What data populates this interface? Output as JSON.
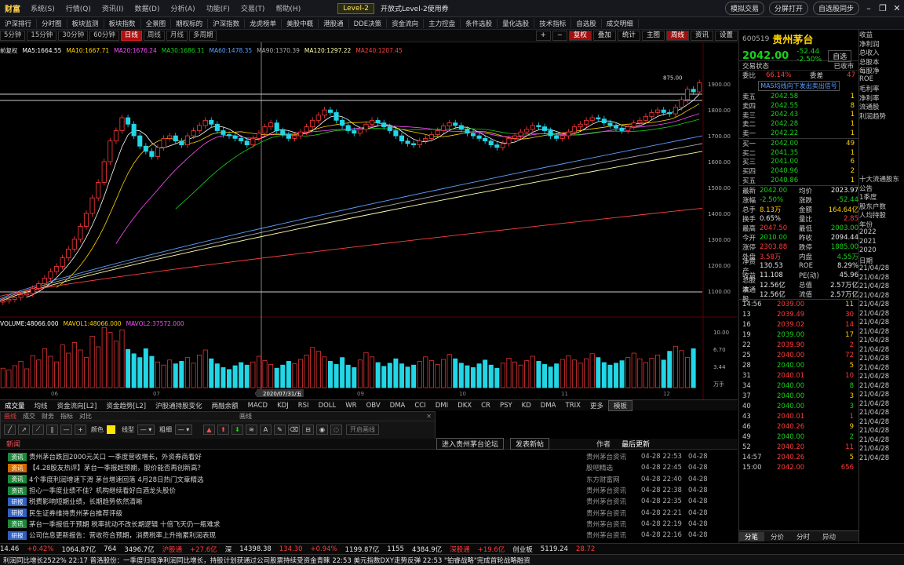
{
  "menubar": {
    "logo": "财富",
    "items": [
      "系统(S)",
      "行情(Q)",
      "资讯(I)",
      "数据(D)",
      "分析(A)",
      "功能(F)",
      "交易(T)",
      "帮助(H)"
    ],
    "promo": "Level-2",
    "promo2": "开放式Level-2使用券",
    "right_items": [
      "模拟交易",
      "分屏打开",
      "自选股同步"
    ]
  },
  "toolbar": {
    "items": [
      "沪深排行",
      "分时图",
      "板块监测",
      "板块指数",
      "全景图",
      "期权标的",
      "沪深指数",
      "龙虎榜单",
      "美股中概",
      "港股通",
      "DDE决策",
      "资金流向",
      "主力控盘",
      "条件选股",
      "量化选股",
      "技术指标",
      "自选股",
      "成交明细"
    ]
  },
  "periodbar": {
    "periods": [
      "5分钟",
      "15分钟",
      "30分钟",
      "60分钟",
      "日线",
      "周线",
      "月线",
      "多周期"
    ],
    "active_index": 4,
    "tools": [
      "+",
      "−",
      "复权",
      "叠加",
      "统计",
      "主图",
      "周线",
      "资讯",
      "设置"
    ]
  },
  "chart_legend": {
    "prefix": "前复权",
    "ma": [
      {
        "label": "MA5:1664.55",
        "color": "#ffffff"
      },
      {
        "label": "MA10:1667.71",
        "color": "#ffd200"
      },
      {
        "label": "MA20:1676.24",
        "color": "#ff4aff"
      },
      {
        "label": "MA30:1686.31",
        "color": "#19d219"
      },
      {
        "label": "MA60:1478.35",
        "color": "#5aa0ff"
      },
      {
        "label": "MA90:1370.39",
        "color": "#aaaaaa"
      },
      {
        "label": "MA120:1297.22",
        "color": "#ffffaa"
      },
      {
        "label": "MA240:1207.45",
        "color": "#ff4040"
      }
    ],
    "vol": [
      {
        "label": "VOLUME:48066.000",
        "color": "#ffffff"
      },
      {
        "label": "MAVOL1:48066.000",
        "color": "#ffd200"
      },
      {
        "label": "MAVOL2:37572.000",
        "color": "#ff4aff"
      }
    ]
  },
  "chart_data": {
    "type": "candlestick",
    "title": "",
    "price_axis": [
      "1900.00",
      "1800.00",
      "1700.00",
      "1600.00",
      "1500.00",
      "1400.00",
      "1300.00",
      "1200.00",
      "1100.00"
    ],
    "volume_axis": [
      "10.00",
      "6.70",
      "3.44",
      "万手"
    ],
    "date_labels": [
      "06",
      "07",
      "08",
      "09",
      "10",
      "11",
      "12"
    ],
    "cursor_date": "2020/07/31/五",
    "peak_label": "875.00",
    "ylim": [
      1060,
      1940
    ],
    "closes": [
      1062,
      1068,
      1075,
      1085,
      1090,
      1110,
      1128,
      1150,
      1175,
      1195,
      1228,
      1262,
      1300,
      1350,
      1400,
      1460,
      1520,
      1600,
      1680,
      1720,
      1770,
      1745,
      1700,
      1660,
      1640,
      1620,
      1655,
      1690,
      1700,
      1680,
      1665,
      1700,
      1720,
      1740,
      1760,
      1745,
      1720,
      1705,
      1700,
      1690,
      1680,
      1665,
      1690,
      1710,
      1735,
      1750,
      1720,
      1705,
      1690,
      1700,
      1715,
      1735,
      1760,
      1780,
      1800,
      1790,
      1760,
      1740,
      1720,
      1710,
      1725,
      1745,
      1760,
      1750,
      1735,
      1720,
      1700,
      1680,
      1670,
      1665,
      1680,
      1690,
      1705,
      1720,
      1738,
      1750,
      1740,
      1725,
      1710,
      1700,
      1690,
      1680,
      1665,
      1655,
      1670,
      1690,
      1700,
      1715,
      1725,
      1740,
      1735,
      1720,
      1700,
      1690,
      1700,
      1715,
      1735,
      1745,
      1760,
      1770,
      1765,
      1750,
      1740,
      1730,
      1720,
      1735,
      1750,
      1760,
      1775,
      1790,
      1800,
      1790,
      1785,
      1810,
      1840,
      1880,
      1870,
      1905
    ],
    "volumes": [
      3.1,
      2.8,
      3.5,
      4.2,
      3.0,
      5.1,
      4.4,
      6.2,
      5.0,
      4.1,
      6.8,
      5.5,
      7.2,
      6.0,
      4.8,
      8.2,
      6.5,
      9.6,
      8.8,
      7.4,
      9.2,
      6.1,
      5.4,
      4.8,
      6.2,
      5.0,
      4.1,
      3.6,
      4.4,
      3.8,
      4.2,
      4.8,
      3.9,
      5.2,
      6.0,
      4.6,
      3.8,
      3.2,
      2.9,
      3.5,
      4.0,
      3.6,
      4.1,
      5.0,
      4.3,
      3.7,
      3.1,
      3.6,
      4.2,
      3.8,
      4.5,
      5.2,
      6.4,
      5.8,
      4.9,
      4.2,
      3.7,
      4.8,
      3.6,
      3.2,
      4.4,
      5.6,
      4.9,
      4.0,
      3.4,
      3.9,
      4.6,
      3.8,
      3.3,
      3.6,
      4.2,
      4.9,
      4.3,
      3.7,
      4.5,
      5.3,
      4.6,
      3.9,
      3.5,
      3.2,
      3.8,
      4.4,
      3.6,
      3.1,
      3.9,
      4.7,
      4.1,
      3.6,
      4.3,
      5.0,
      4.2,
      3.7,
      3.3,
      3.8,
      4.5,
      5.1,
      4.4,
      3.9,
      4.6,
      5.4,
      4.8,
      4.0,
      3.6,
      3.9,
      4.3,
      4.8,
      5.5,
      4.6,
      4.0,
      4.7,
      5.2,
      4.4,
      5.8,
      6.6,
      5.9,
      4.8,
      6.2
    ]
  },
  "ind_tabs": [
    "成交量",
    "均线",
    "资金流向[L2]",
    "资金趋势[L2]",
    "沪股通持股变化",
    "两融余额",
    "MACD",
    "KDJ",
    "RSI",
    "DOLL",
    "WR",
    "OBV",
    "DMA",
    "CCI",
    "DMI",
    "DKX",
    "CR",
    "PSY",
    "KD",
    "DMA",
    "TRIX",
    "更多",
    "模板"
  ],
  "draw_panel": {
    "tabs": [
      "画线",
      "成交",
      "财务",
      "指标",
      "对比"
    ],
    "title": "画线",
    "color_label": "颜色",
    "style_label": "线型",
    "width_label": "粗细",
    "hide_label": "隐藏",
    "open_label": "开启画线"
  },
  "news_head": {
    "tab": "新闻",
    "buttons": [
      "进入贵州茅台论坛",
      "发表新帖"
    ],
    "cols": [
      "作者",
      "最后更新"
    ]
  },
  "news": [
    {
      "tag": "资讯",
      "tagcolor": "#1c8a3a",
      "title": "贵州茅台跌回2000元关口 一季度营收增长，外资券商看好",
      "src": "贵州茅台资讯",
      "t1": "04-28 22:53",
      "t2": "04-28"
    },
    {
      "tag": "资讯",
      "tagcolor": "#d06a00",
      "title": "【4.28股友热评】茅台一季报超预期，股价能否再创新高？",
      "src": "股吧精选",
      "t1": "04-28 22:45",
      "t2": "04-28"
    },
    {
      "tag": "资讯",
      "tagcolor": "#1c8a3a",
      "title": "4个季度利润增速下滑 茅台增速回落 4月28日热门文章精选",
      "src": "东方财富网",
      "t1": "04-28 22:40",
      "t2": "04-28"
    },
    {
      "tag": "资讯",
      "tagcolor": "#1c8a3a",
      "title": "担心一季度业绩不佳？机构继续看好白酒龙头股价",
      "src": "贵州茅台资讯",
      "t1": "04-28 22:38",
      "t2": "04-28"
    },
    {
      "tag": "研报",
      "tagcolor": "#3060c0",
      "title": "税费影响短期业绩，长期趋势依然清晰",
      "src": "贵州茅台资讯",
      "t1": "04-28 22:35",
      "t2": "04-28"
    },
    {
      "tag": "研报",
      "tagcolor": "#3060c0",
      "title": "民生证券维持贵州茅台推荐评级",
      "src": "贵州茅台资讯",
      "t1": "04-28 22:21",
      "t2": "04-28"
    },
    {
      "tag": "资讯",
      "tagcolor": "#1c8a3a",
      "title": "茅台一季报低于预期 税率扰动不改长期逻辑 十倍飞天仍一瓶难求",
      "src": "贵州茅台资讯",
      "t1": "04-28 22:19",
      "t2": "04-28"
    },
    {
      "tag": "研报",
      "tagcolor": "#3060c0",
      "title": "公司信息更新报告：营收符合预期，消费税率上升拖累利润表现",
      "src": "贵州茅台资讯",
      "t1": "04-28 22:16",
      "t2": "04-28"
    }
  ],
  "status": [
    {
      "text": "14.46",
      "cls": "white"
    },
    {
      "text": "+0.42%",
      "cls": "red"
    },
    {
      "text": "1064.87亿",
      "cls": "white"
    },
    {
      "text": "764",
      "cls": "white"
    },
    {
      "text": "3496.7亿",
      "cls": "white"
    },
    {
      "text": "沪股通",
      "cls": "red"
    },
    {
      "text": "+27.6亿",
      "cls": "red"
    },
    {
      "text": "深",
      "cls": "white"
    },
    {
      "text": "14398.38",
      "cls": "white"
    },
    {
      "text": "134.30",
      "cls": "red"
    },
    {
      "text": "+0.94%",
      "cls": "red"
    },
    {
      "text": "1199.87亿",
      "cls": "white"
    },
    {
      "text": "1155",
      "cls": "white"
    },
    {
      "text": "4384.9亿",
      "cls": "white"
    },
    {
      "text": "深股通",
      "cls": "red"
    },
    {
      "text": "+19.6亿",
      "cls": "red"
    },
    {
      "text": "创业板",
      "cls": "white"
    },
    {
      "text": "5119.24",
      "cls": "white"
    },
    {
      "text": "28.72",
      "cls": "red"
    }
  ],
  "ticker": "利润同比增长2522%   22:17 普洛股份：一季度归母净利润同比增长，持股计划获通过公司股票持续受资金青睐   22:53 美元指数DXY走势反弹   22:53 \"铂睿战略\"完成首轮战略融资",
  "rpanel": {
    "code": "600519",
    "name": "贵州茅台",
    "price": "2042.00",
    "change": "-52.44",
    "pct": "-2.50%",
    "btn": "自选",
    "tabs": [
      "交易状态",
      "已收市"
    ],
    "ratio_label": "委比",
    "ratio_val": "66.14%",
    "diff_label": "委差",
    "diff_val": "47",
    "signal": "MA5均线向下发出卖出信号",
    "sells": [
      {
        "l": "卖五",
        "p": "2042.58",
        "v": "1"
      },
      {
        "l": "卖四",
        "p": "2042.55",
        "v": "8"
      },
      {
        "l": "卖三",
        "p": "2042.43",
        "v": "1"
      },
      {
        "l": "卖二",
        "p": "2042.28",
        "v": "1"
      },
      {
        "l": "卖一",
        "p": "2042.22",
        "v": "1"
      }
    ],
    "buys": [
      {
        "l": "买一",
        "p": "2042.00",
        "v": "49"
      },
      {
        "l": "买二",
        "p": "2041.35",
        "v": "1"
      },
      {
        "l": "买三",
        "p": "2041.00",
        "v": "6"
      },
      {
        "l": "买四",
        "p": "2040.96",
        "v": "2"
      },
      {
        "l": "买五",
        "p": "2040.86",
        "v": "1"
      }
    ],
    "quotes": [
      {
        "k1": "最新",
        "v1": "2042.00",
        "c1": "green",
        "k2": "均价",
        "v2": "2023.97",
        "c2": "white"
      },
      {
        "k1": "涨幅",
        "v1": "-2.50%",
        "c1": "green",
        "k2": "涨跌",
        "v2": "-52.44",
        "c2": "green"
      },
      {
        "k1": "总手",
        "v1": "8.13万",
        "c1": "yellow",
        "k2": "金额",
        "v2": "164.64亿",
        "c2": "yellow"
      },
      {
        "k1": "换手",
        "v1": "0.65%",
        "c1": "white",
        "k2": "量比",
        "v2": "2.85",
        "c2": "red"
      },
      {
        "k1": "最高",
        "v1": "2047.50",
        "c1": "red",
        "k2": "最低",
        "v2": "2003.00",
        "c2": "green"
      },
      {
        "k1": "今开",
        "v1": "2010.00",
        "c1": "green",
        "k2": "昨收",
        "v2": "2094.44",
        "c2": "white"
      },
      {
        "k1": "涨停",
        "v1": "2303.88",
        "c1": "red",
        "k2": "跌停",
        "v2": "1885.00",
        "c2": "green"
      },
      {
        "k1": "外盘",
        "v1": "3.58万",
        "c1": "red",
        "k2": "内盘",
        "v2": "4.55万",
        "c2": "green"
      },
      {
        "k1": "净资产",
        "v1": "130.53",
        "c1": "white",
        "k2": "ROE",
        "v2": "8.29%",
        "c2": "white"
      },
      {
        "k1": "收益",
        "v1": "11.108",
        "c1": "white",
        "k2": "PE(动)",
        "v2": "45.96",
        "c2": "white"
      },
      {
        "k1": "总股本",
        "v1": "12.56亿",
        "c1": "white",
        "k2": "总值",
        "v2": "2.57万亿",
        "c2": "white"
      },
      {
        "k1": "流通股",
        "v1": "12.56亿",
        "c1": "white",
        "k2": "流值",
        "v2": "2.57万亿",
        "c2": "white"
      }
    ],
    "ticks": [
      {
        "t": "14:56",
        "p": "2039.00",
        "v": "11",
        "c": "red"
      },
      {
        "t": "13",
        "p": "2039.49",
        "v": "30",
        "c": "red"
      },
      {
        "t": "16",
        "p": "2039.02",
        "v": "14",
        "c": "red"
      },
      {
        "t": "19",
        "p": "2039.00",
        "v": "17",
        "c": "green"
      },
      {
        "t": "22",
        "p": "2039.90",
        "v": "2",
        "c": "red"
      },
      {
        "t": "25",
        "p": "2040.00",
        "v": "72",
        "c": "red"
      },
      {
        "t": "28",
        "p": "2040.00",
        "v": "5",
        "c": "green"
      },
      {
        "t": "31",
        "p": "2040.01",
        "v": "10",
        "c": "red"
      },
      {
        "t": "34",
        "p": "2040.00",
        "v": "8",
        "c": "green"
      },
      {
        "t": "37",
        "p": "2040.00",
        "v": "3",
        "c": "green"
      },
      {
        "t": "40",
        "p": "2040.00",
        "v": "3",
        "c": "green"
      },
      {
        "t": "43",
        "p": "2040.01",
        "v": "1",
        "c": "red"
      },
      {
        "t": "46",
        "p": "2040.26",
        "v": "9",
        "c": "red"
      },
      {
        "t": "49",
        "p": "2040.00",
        "v": "2",
        "c": "green"
      },
      {
        "t": "52",
        "p": "2040.20",
        "v": "11",
        "c": "red"
      },
      {
        "t": "14:57",
        "p": "2040.26",
        "v": "5",
        "c": "red"
      },
      {
        "t": "15:00",
        "p": "2042.00",
        "v": "656",
        "c": "red"
      }
    ],
    "bottom_tabs": [
      "分笔",
      "分价",
      "分时",
      "异动"
    ]
  },
  "fpanel": {
    "rows": [
      "收益",
      "净利润",
      "总收入",
      "总股本",
      "每股净",
      "ROE",
      "毛利率",
      "净利率",
      "流通股",
      "利润趋势",
      "",
      "",
      "",
      "",
      "",
      "",
      "十大流通股东",
      "公告",
      "1季度",
      "股东户数",
      "人均持股",
      "年份",
      "2022",
      "2021",
      "2020",
      "日期",
      "21/04/28",
      "21/04/28",
      "21/04/28",
      "21/04/28",
      "21/04/28",
      "21/04/28",
      "21/04/28",
      "21/04/28",
      "21/04/28",
      "21/04/28",
      "21/04/28",
      "21/04/28",
      "21/04/28",
      "21/04/28",
      "21/04/28",
      "21/04/28",
      "21/04/28",
      "21/04/28",
      "21/04/28",
      "21/04/28",
      "21/04/28",
      "21/04/28"
    ]
  }
}
